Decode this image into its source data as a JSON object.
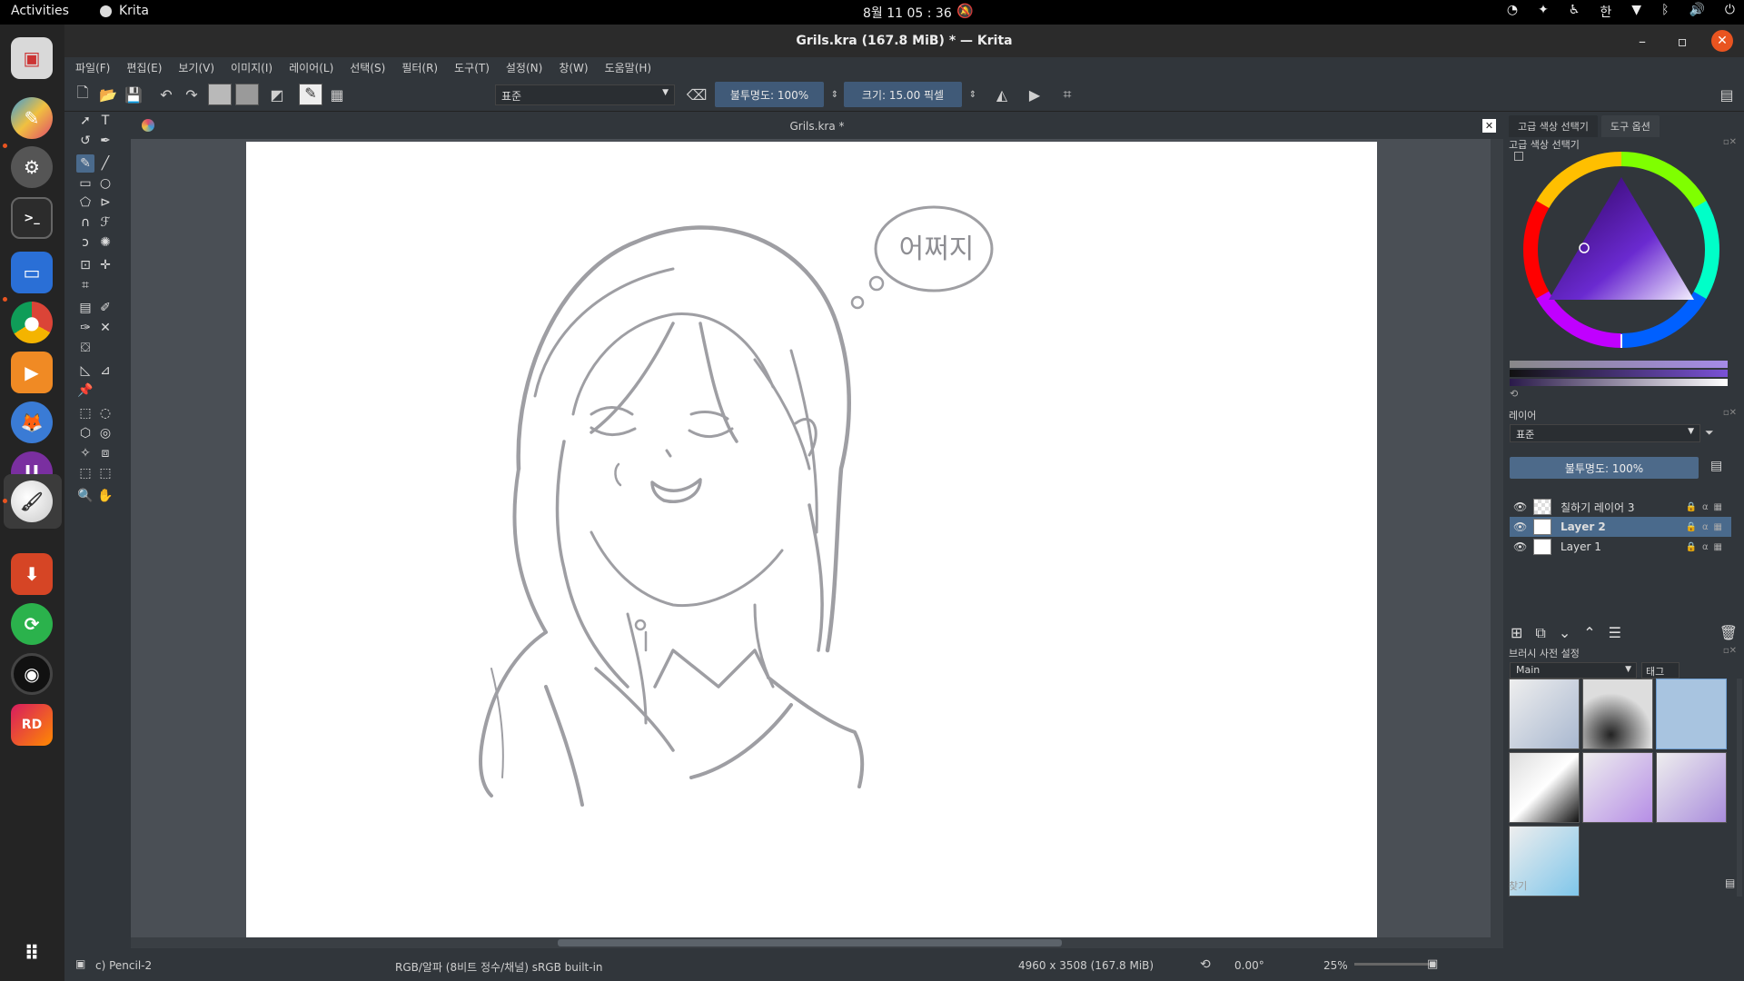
{
  "topbar": {
    "activities": "Activities",
    "app_name": "Krita",
    "clock": "8월 11  05 : 36",
    "input_method": "한"
  },
  "window": {
    "title": "Grils.kra (167.8 MiB)  * — Krita"
  },
  "menu": {
    "items": [
      "파일(F)",
      "편집(E)",
      "보기(V)",
      "이미지(I)",
      "레이어(L)",
      "선택(S)",
      "필터(R)",
      "도구(T)",
      "설정(N)",
      "창(W)",
      "도움말(H)"
    ]
  },
  "toolbar": {
    "blend_mode": "표준",
    "opacity": "불투명도: 100%",
    "size": "크기: 15.00 픽셀"
  },
  "document": {
    "tab_title": "Grils.kra *",
    "thought_text": "어쩌지"
  },
  "right_dock": {
    "tabs": [
      "고급 색상 선택기",
      "도구 옵션"
    ],
    "color_selector_title": "고급 색상 선택기",
    "layers_title": "레이어",
    "layer_blend": "표준",
    "layer_opacity": "불투명도:  100%",
    "layers": [
      {
        "name": "칠하기 레이어 3",
        "selected": false
      },
      {
        "name": "Layer 2",
        "selected": true
      },
      {
        "name": "Layer 1",
        "selected": false
      }
    ],
    "brush_presets_title": "브러시 사전 설정",
    "brush_tag": "Main",
    "brush_tag_label": "태그",
    "search_placeholder": "찾기"
  },
  "statusbar": {
    "brush": "c) Pencil-2",
    "color_space": "RGB/알파 (8비트 정수/채널)  sRGB built-in",
    "dimensions": "4960 x 3508 (167.8 MiB)",
    "rotation": "0.00°",
    "zoom": "25%"
  },
  "colors": {
    "accent": "#e95420",
    "selection": "#4a6a8c",
    "sketch_stroke": "#8e8e93"
  }
}
